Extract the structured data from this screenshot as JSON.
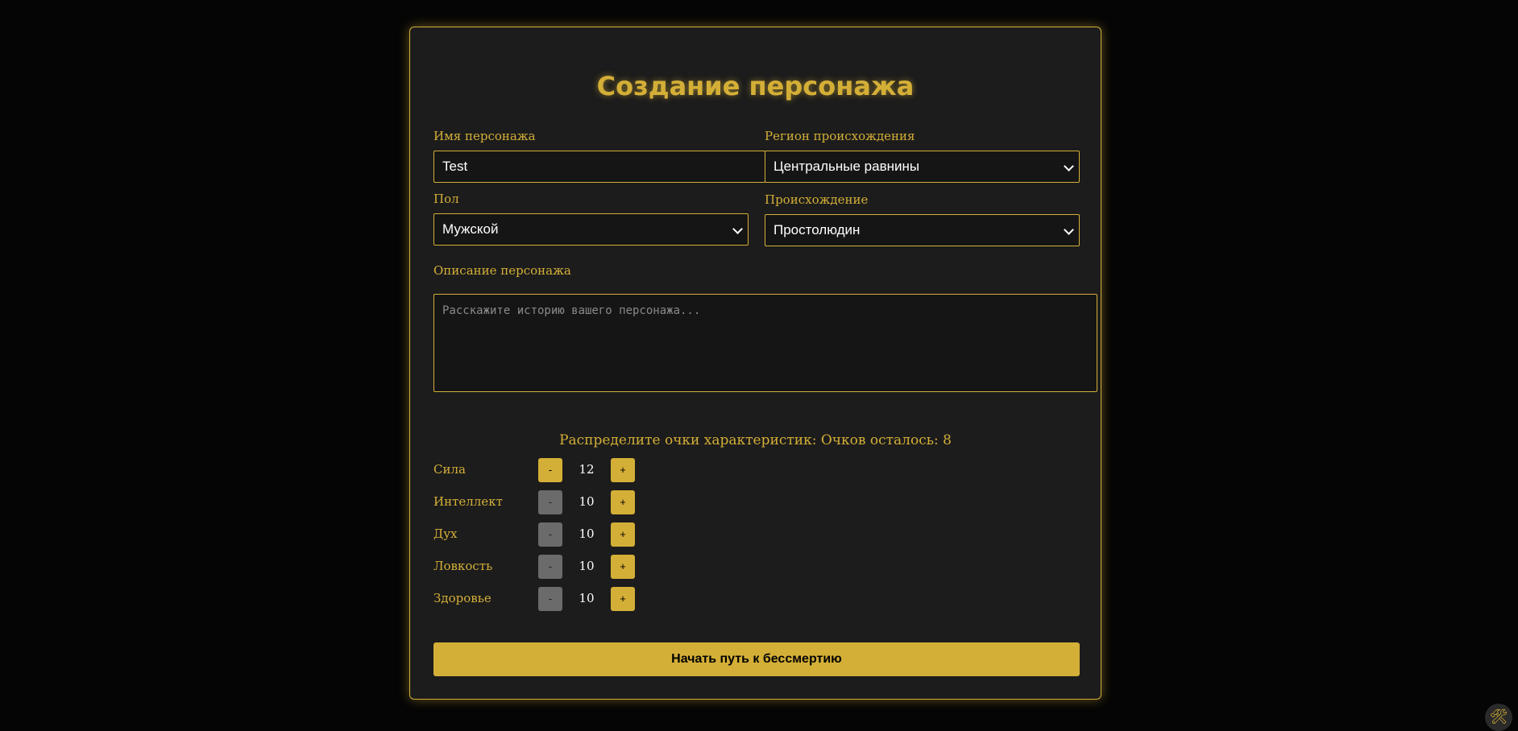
{
  "form": {
    "title": "Создание персонажа",
    "name_label": "Имя персонажа",
    "name_value": "Test",
    "region_label": "Регион происхождения",
    "region_value": "Центральные равнины",
    "gender_label": "Пол",
    "gender_value": "Мужской",
    "origin_label": "Происхождение",
    "origin_value": "Простолюдин",
    "description_label": "Описание персонажа",
    "description_placeholder": "Расскажите историю вашего персонажа...",
    "points_text": "Распределите очки характеристик: Очков осталось: 8",
    "stats": [
      {
        "name": "Сила",
        "value": "12",
        "minus": "-",
        "plus": "+",
        "minus_enabled": true
      },
      {
        "name": "Интеллект",
        "value": "10",
        "minus": "-",
        "plus": "+",
        "minus_enabled": false
      },
      {
        "name": "Дух",
        "value": "10",
        "minus": "-",
        "plus": "+",
        "minus_enabled": false
      },
      {
        "name": "Ловкость",
        "value": "10",
        "minus": "-",
        "plus": "+",
        "minus_enabled": false
      },
      {
        "name": "Здоровье",
        "value": "10",
        "minus": "-",
        "plus": "+",
        "minus_enabled": false
      }
    ],
    "submit_label": "Начать путь к бессмертию"
  },
  "tool_icon": "hammer-wrench-icon",
  "colors": {
    "accent": "#d4af37",
    "background": "#050505",
    "panel": "#1c1c1c",
    "disabled": "#6b6b6b"
  }
}
